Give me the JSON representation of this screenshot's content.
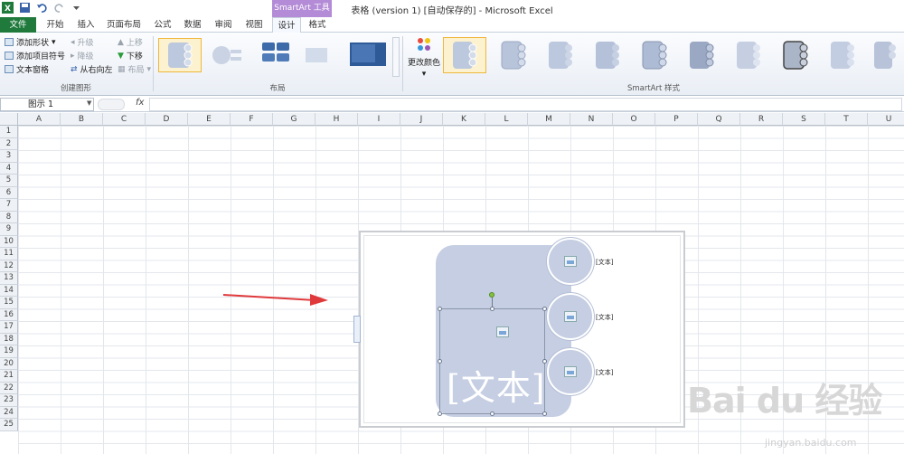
{
  "window": {
    "title": "表格 (version 1) [自动保存的] - Microsoft Excel",
    "contextual_tab_group": "SmartArt 工具"
  },
  "tabs": [
    {
      "label": "文件"
    },
    {
      "label": "开始"
    },
    {
      "label": "插入"
    },
    {
      "label": "页面布局"
    },
    {
      "label": "公式"
    },
    {
      "label": "数据"
    },
    {
      "label": "审阅"
    },
    {
      "label": "视图"
    },
    {
      "label": "设计"
    },
    {
      "label": "格式"
    }
  ],
  "ribbon": {
    "create_graphic": {
      "label": "创建图形",
      "add_shape": "添加形状",
      "add_bullet": "添加项目符号",
      "text_pane": "文本窗格",
      "promote": "升级",
      "demote": "降级",
      "right_to_left": "从右向左",
      "move_up": "上移",
      "move_down": "下移",
      "layout": "布局"
    },
    "layouts": {
      "label": "布局"
    },
    "styles": {
      "label": "SmartArt 样式",
      "change_colors": "更改颜色"
    }
  },
  "formula_bar": {
    "name_box": "图示 1",
    "fx": "fx",
    "formula": ""
  },
  "columns": [
    "A",
    "B",
    "C",
    "D",
    "E",
    "F",
    "G",
    "H",
    "I",
    "J",
    "K",
    "L",
    "M",
    "N",
    "O",
    "P",
    "Q",
    "R",
    "S",
    "T",
    "U"
  ],
  "rows": [
    "1",
    "2",
    "3",
    "4",
    "5",
    "6",
    "7",
    "8",
    "9",
    "10",
    "11",
    "12",
    "13",
    "14",
    "15",
    "16",
    "17",
    "18",
    "19",
    "20",
    "21",
    "22",
    "23",
    "24",
    "25"
  ],
  "smartart": {
    "main_text": "[文本]",
    "bullet_labels": [
      "[文本]",
      "[文本]",
      "[文本]"
    ]
  },
  "watermark": {
    "main": "Bai du 经验",
    "sub": "jingyan.baidu.com"
  },
  "colors": {
    "file_tab": "#1f7a3c",
    "smartart_tools": "#b38bd6",
    "shape_fill": "#c5cee2",
    "arrow": "#e0393b"
  }
}
